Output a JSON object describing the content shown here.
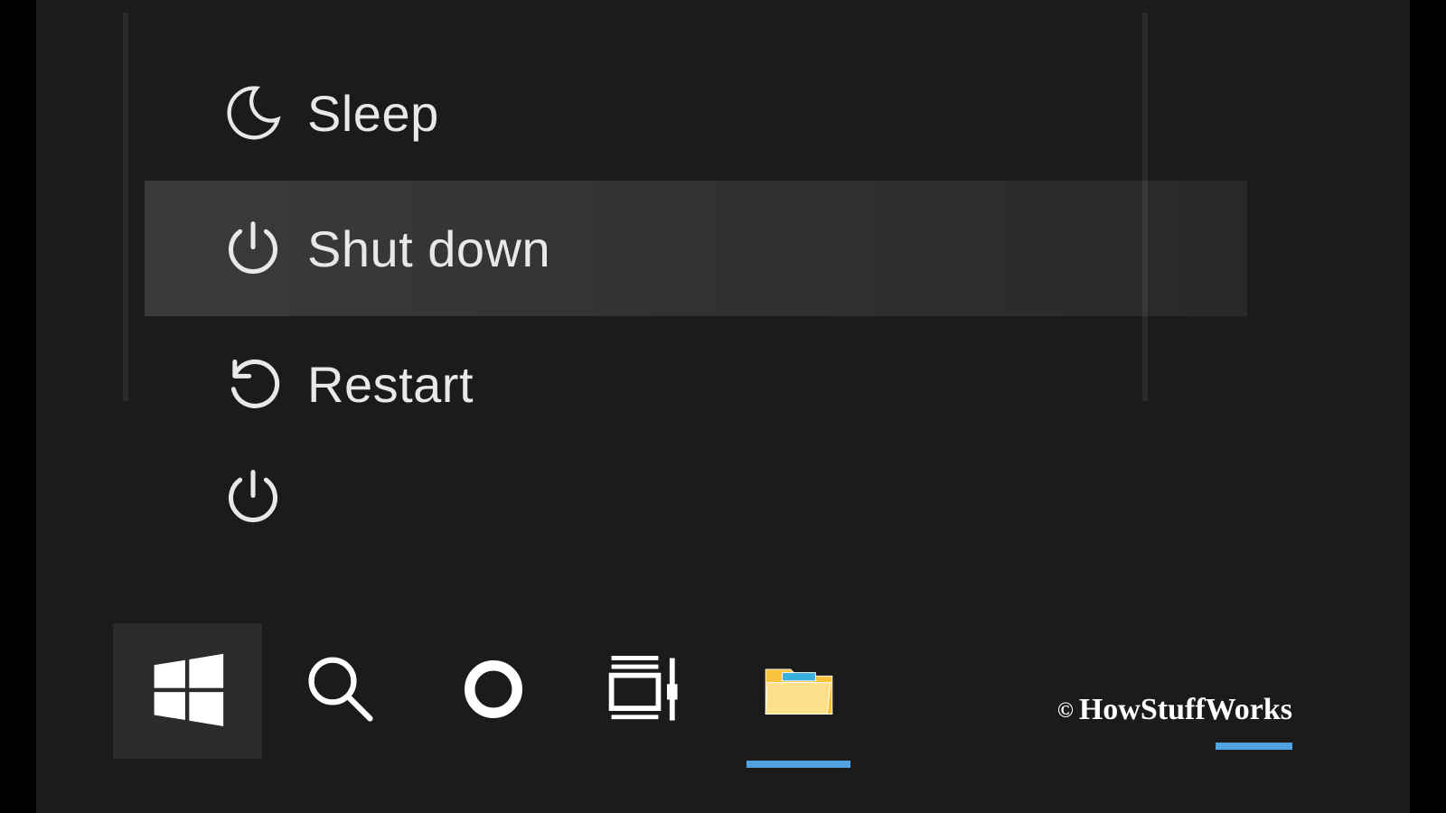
{
  "power_menu": {
    "items": [
      {
        "icon": "moon-icon",
        "label": "Sleep",
        "hover": false
      },
      {
        "icon": "power-icon",
        "label": "Shut down",
        "hover": true
      },
      {
        "icon": "restart-icon",
        "label": "Restart",
        "hover": false
      }
    ],
    "standalone_power_icon": "power-icon"
  },
  "taskbar": {
    "items": [
      {
        "name": "start",
        "icon": "windows-logo-icon",
        "active": false,
        "highlighted": true
      },
      {
        "name": "search",
        "icon": "search-icon",
        "active": false,
        "highlighted": false
      },
      {
        "name": "cortana",
        "icon": "cortana-ring-icon",
        "active": false,
        "highlighted": false
      },
      {
        "name": "task-view",
        "icon": "task-view-icon",
        "active": false,
        "highlighted": false
      },
      {
        "name": "file-explorer",
        "icon": "file-explorer-icon",
        "active": true,
        "highlighted": false
      }
    ]
  },
  "watermark": {
    "symbol": "©",
    "text": "HowStuffWorks"
  }
}
